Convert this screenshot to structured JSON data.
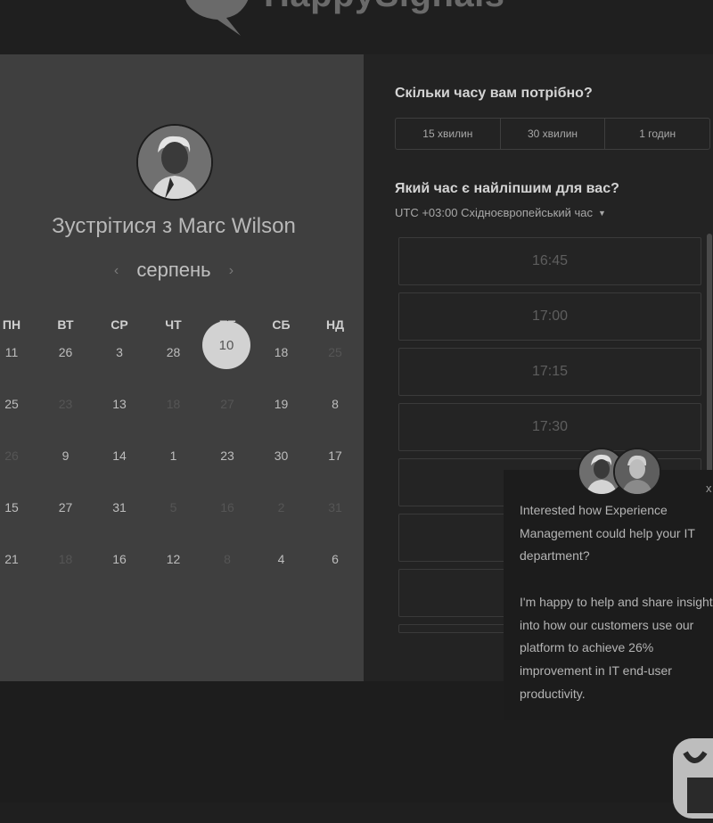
{
  "header": {
    "brand": "HappySignals"
  },
  "booking": {
    "meet_title": "Зустрітися з Marc Wilson",
    "month": "серпень",
    "weekdays": [
      "ПН",
      "ВТ",
      "СР",
      "ЧТ",
      "ПТ",
      "СБ",
      "НД"
    ],
    "selected_day": "10",
    "rows": [
      [
        {
          "d": "11",
          "dim": false
        },
        {
          "d": "26",
          "dim": false
        },
        {
          "d": "3",
          "dim": false
        },
        {
          "d": "28",
          "dim": false
        },
        {
          "d": "10",
          "dim": false
        },
        {
          "d": "18",
          "dim": false
        },
        {
          "d": "25",
          "dim": true
        }
      ],
      [
        {
          "d": "25",
          "dim": false
        },
        {
          "d": "23",
          "dim": true
        },
        {
          "d": "13",
          "dim": false
        },
        {
          "d": "18",
          "dim": true
        },
        {
          "d": "27",
          "dim": true
        },
        {
          "d": "19",
          "dim": false
        },
        {
          "d": "8",
          "dim": false
        }
      ],
      [
        {
          "d": "26",
          "dim": true
        },
        {
          "d": "9",
          "dim": false
        },
        {
          "d": "14",
          "dim": false
        },
        {
          "d": "1",
          "dim": false
        },
        {
          "d": "23",
          "dim": false
        },
        {
          "d": "30",
          "dim": false
        },
        {
          "d": "17",
          "dim": false
        }
      ],
      [
        {
          "d": "15",
          "dim": false
        },
        {
          "d": "27",
          "dim": false
        },
        {
          "d": "31",
          "dim": false
        },
        {
          "d": "5",
          "dim": true
        },
        {
          "d": "16",
          "dim": true
        },
        {
          "d": "2",
          "dim": true
        },
        {
          "d": "31",
          "dim": true
        }
      ],
      [
        {
          "d": "21",
          "dim": false
        },
        {
          "d": "18",
          "dim": true
        },
        {
          "d": "16",
          "dim": false
        },
        {
          "d": "12",
          "dim": false
        },
        {
          "d": "8",
          "dim": true
        },
        {
          "d": "4",
          "dim": false
        },
        {
          "d": "6",
          "dim": false
        }
      ]
    ]
  },
  "scheduler": {
    "duration_question": "Скільки часу вам потрібно?",
    "durations": [
      "15 хвилин",
      "30 хвилин",
      "1 годин"
    ],
    "time_question": "Який час є найліпшим для вас?",
    "timezone": "UTC +03:00 Східноєвропейський час",
    "slots": [
      "16:45",
      "17:00",
      "17:15",
      "17:30",
      "",
      "",
      "",
      ""
    ]
  },
  "chat": {
    "paragraph1": "Interested how Experience Management could help your IT department?",
    "paragraph2": "I'm happy to help and share insight into how our customers use our platform to achieve 26% improvement in IT end-user productivity.",
    "close_label": "x"
  }
}
